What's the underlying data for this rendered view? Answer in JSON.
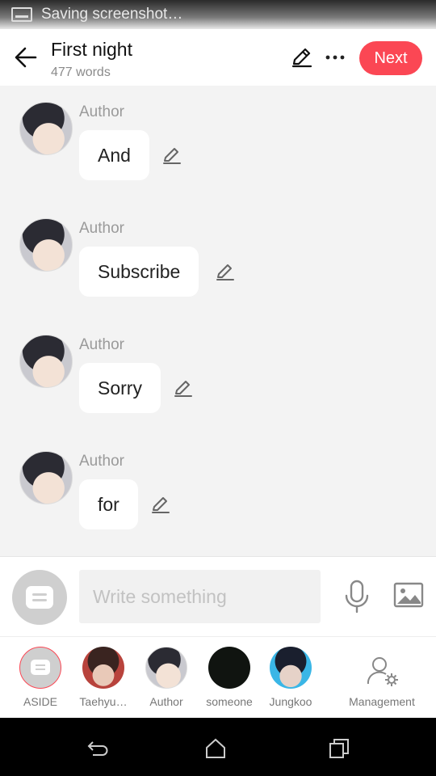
{
  "status_bar": {
    "text": "Saving screenshot…"
  },
  "header": {
    "title": "First night",
    "subtitle": "477 words",
    "next_label": "Next",
    "icons": [
      "back-arrow-icon",
      "edit-icon",
      "more-icon"
    ]
  },
  "messages": [
    {
      "speaker": "Author",
      "text": "And"
    },
    {
      "speaker": "Author",
      "text": "Subscribe"
    },
    {
      "speaker": "Author",
      "text": "Sorry"
    },
    {
      "speaker": "Author",
      "text": "for"
    }
  ],
  "input": {
    "placeholder": "Write something",
    "value": ""
  },
  "characters": [
    {
      "name": "ASIDE"
    },
    {
      "name": "Taehyu…"
    },
    {
      "name": "Author"
    },
    {
      "name": "someone"
    },
    {
      "name": "Jungkoo"
    }
  ],
  "management_label": "Management",
  "colors": {
    "accent": "#fb4754",
    "background": "#f3f3f3",
    "bubble": "#ffffff"
  }
}
